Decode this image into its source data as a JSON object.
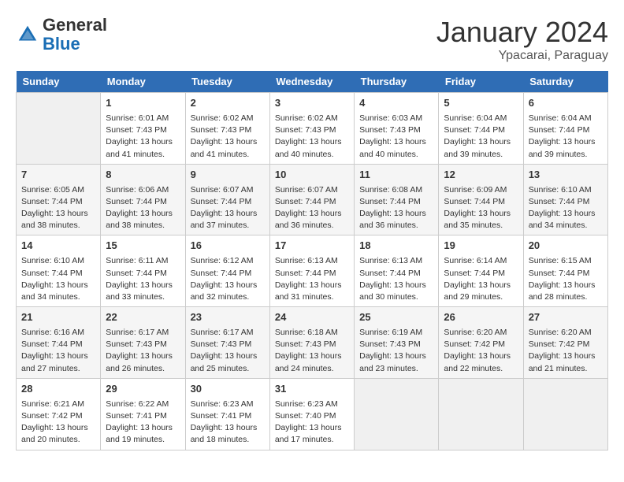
{
  "header": {
    "logo_general": "General",
    "logo_blue": "Blue",
    "month_year": "January 2024",
    "location": "Ypacarai, Paraguay"
  },
  "columns": [
    "Sunday",
    "Monday",
    "Tuesday",
    "Wednesday",
    "Thursday",
    "Friday",
    "Saturday"
  ],
  "weeks": [
    [
      {
        "day": "",
        "empty": true
      },
      {
        "day": "1",
        "sunrise": "6:01 AM",
        "sunset": "7:43 PM",
        "daylight": "13 hours and 41 minutes."
      },
      {
        "day": "2",
        "sunrise": "6:02 AM",
        "sunset": "7:43 PM",
        "daylight": "13 hours and 41 minutes."
      },
      {
        "day": "3",
        "sunrise": "6:02 AM",
        "sunset": "7:43 PM",
        "daylight": "13 hours and 40 minutes."
      },
      {
        "day": "4",
        "sunrise": "6:03 AM",
        "sunset": "7:43 PM",
        "daylight": "13 hours and 40 minutes."
      },
      {
        "day": "5",
        "sunrise": "6:04 AM",
        "sunset": "7:44 PM",
        "daylight": "13 hours and 39 minutes."
      },
      {
        "day": "6",
        "sunrise": "6:04 AM",
        "sunset": "7:44 PM",
        "daylight": "13 hours and 39 minutes."
      }
    ],
    [
      {
        "day": "7",
        "sunrise": "6:05 AM",
        "sunset": "7:44 PM",
        "daylight": "13 hours and 38 minutes."
      },
      {
        "day": "8",
        "sunrise": "6:06 AM",
        "sunset": "7:44 PM",
        "daylight": "13 hours and 38 minutes."
      },
      {
        "day": "9",
        "sunrise": "6:07 AM",
        "sunset": "7:44 PM",
        "daylight": "13 hours and 37 minutes."
      },
      {
        "day": "10",
        "sunrise": "6:07 AM",
        "sunset": "7:44 PM",
        "daylight": "13 hours and 36 minutes."
      },
      {
        "day": "11",
        "sunrise": "6:08 AM",
        "sunset": "7:44 PM",
        "daylight": "13 hours and 36 minutes."
      },
      {
        "day": "12",
        "sunrise": "6:09 AM",
        "sunset": "7:44 PM",
        "daylight": "13 hours and 35 minutes."
      },
      {
        "day": "13",
        "sunrise": "6:10 AM",
        "sunset": "7:44 PM",
        "daylight": "13 hours and 34 minutes."
      }
    ],
    [
      {
        "day": "14",
        "sunrise": "6:10 AM",
        "sunset": "7:44 PM",
        "daylight": "13 hours and 34 minutes."
      },
      {
        "day": "15",
        "sunrise": "6:11 AM",
        "sunset": "7:44 PM",
        "daylight": "13 hours and 33 minutes."
      },
      {
        "day": "16",
        "sunrise": "6:12 AM",
        "sunset": "7:44 PM",
        "daylight": "13 hours and 32 minutes."
      },
      {
        "day": "17",
        "sunrise": "6:13 AM",
        "sunset": "7:44 PM",
        "daylight": "13 hours and 31 minutes."
      },
      {
        "day": "18",
        "sunrise": "6:13 AM",
        "sunset": "7:44 PM",
        "daylight": "13 hours and 30 minutes."
      },
      {
        "day": "19",
        "sunrise": "6:14 AM",
        "sunset": "7:44 PM",
        "daylight": "13 hours and 29 minutes."
      },
      {
        "day": "20",
        "sunrise": "6:15 AM",
        "sunset": "7:44 PM",
        "daylight": "13 hours and 28 minutes."
      }
    ],
    [
      {
        "day": "21",
        "sunrise": "6:16 AM",
        "sunset": "7:44 PM",
        "daylight": "13 hours and 27 minutes."
      },
      {
        "day": "22",
        "sunrise": "6:17 AM",
        "sunset": "7:43 PM",
        "daylight": "13 hours and 26 minutes."
      },
      {
        "day": "23",
        "sunrise": "6:17 AM",
        "sunset": "7:43 PM",
        "daylight": "13 hours and 25 minutes."
      },
      {
        "day": "24",
        "sunrise": "6:18 AM",
        "sunset": "7:43 PM",
        "daylight": "13 hours and 24 minutes."
      },
      {
        "day": "25",
        "sunrise": "6:19 AM",
        "sunset": "7:43 PM",
        "daylight": "13 hours and 23 minutes."
      },
      {
        "day": "26",
        "sunrise": "6:20 AM",
        "sunset": "7:42 PM",
        "daylight": "13 hours and 22 minutes."
      },
      {
        "day": "27",
        "sunrise": "6:20 AM",
        "sunset": "7:42 PM",
        "daylight": "13 hours and 21 minutes."
      }
    ],
    [
      {
        "day": "28",
        "sunrise": "6:21 AM",
        "sunset": "7:42 PM",
        "daylight": "13 hours and 20 minutes."
      },
      {
        "day": "29",
        "sunrise": "6:22 AM",
        "sunset": "7:41 PM",
        "daylight": "13 hours and 19 minutes."
      },
      {
        "day": "30",
        "sunrise": "6:23 AM",
        "sunset": "7:41 PM",
        "daylight": "13 hours and 18 minutes."
      },
      {
        "day": "31",
        "sunrise": "6:23 AM",
        "sunset": "7:40 PM",
        "daylight": "13 hours and 17 minutes."
      },
      {
        "day": "",
        "empty": true
      },
      {
        "day": "",
        "empty": true
      },
      {
        "day": "",
        "empty": true
      }
    ]
  ],
  "labels": {
    "sunrise": "Sunrise:",
    "sunset": "Sunset:",
    "daylight": "Daylight:"
  }
}
